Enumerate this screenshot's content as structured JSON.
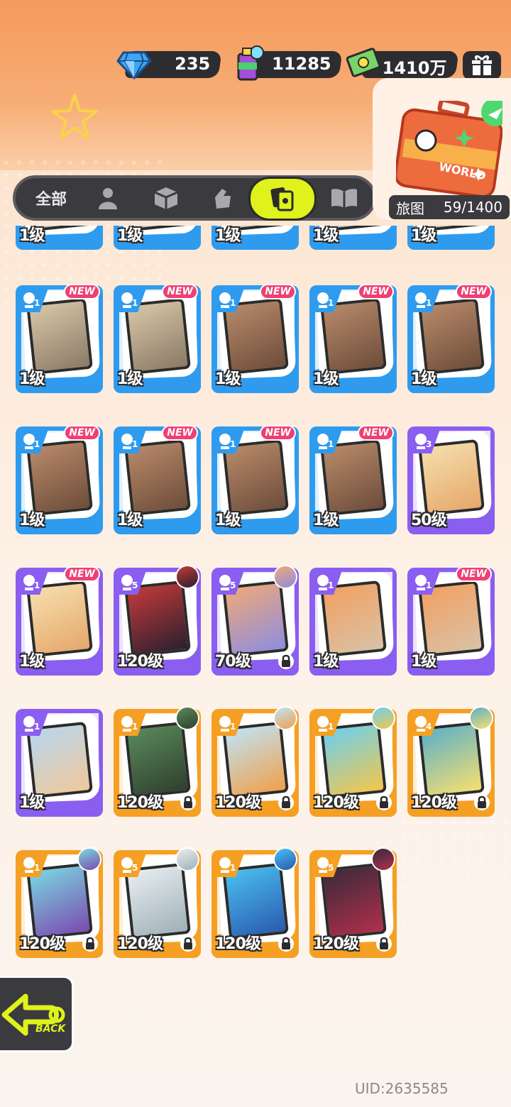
{
  "currency": {
    "diamonds": "235",
    "tickets": "11285",
    "cash": "1410万"
  },
  "tabs": {
    "all_label": "全部",
    "items": [
      "all",
      "character",
      "box",
      "hand",
      "cards",
      "book"
    ],
    "active": "cards"
  },
  "world": {
    "label": "旅图",
    "progress": "59/1400",
    "badge_text": "WORLD"
  },
  "colors": {
    "blue": "#2f9bef",
    "purple": "#8a5ef0",
    "orange": "#f5a024",
    "accent": "#dff21b"
  },
  "cards": [
    {
      "rarity": "blue",
      "num": "",
      "level": "1级",
      "new": false,
      "avatar": false,
      "lock": false,
      "partial": true
    },
    {
      "rarity": "blue",
      "num": "",
      "level": "1级",
      "new": false,
      "avatar": false,
      "lock": false,
      "partial": true
    },
    {
      "rarity": "blue",
      "num": "",
      "level": "1级",
      "new": false,
      "avatar": false,
      "lock": false,
      "partial": true
    },
    {
      "rarity": "blue",
      "num": "",
      "level": "1级",
      "new": false,
      "avatar": false,
      "lock": false,
      "partial": true
    },
    {
      "rarity": "blue",
      "num": "",
      "level": "1级",
      "new": false,
      "avatar": false,
      "lock": false,
      "partial": true
    },
    {
      "rarity": "blue",
      "num": "1",
      "level": "1级",
      "new": true,
      "avatar": false,
      "lock": false,
      "art": "tower"
    },
    {
      "rarity": "blue",
      "num": "1",
      "level": "1级",
      "new": true,
      "avatar": false,
      "lock": false,
      "art": "tower"
    },
    {
      "rarity": "blue",
      "num": "1",
      "level": "1级",
      "new": true,
      "avatar": false,
      "lock": false,
      "art": "bath"
    },
    {
      "rarity": "blue",
      "num": "1",
      "level": "1级",
      "new": true,
      "avatar": false,
      "lock": false,
      "art": "bath"
    },
    {
      "rarity": "blue",
      "num": "1",
      "level": "1级",
      "new": true,
      "avatar": false,
      "lock": false,
      "art": "bath"
    },
    {
      "rarity": "blue",
      "num": "1",
      "level": "1级",
      "new": true,
      "avatar": false,
      "lock": false,
      "art": "bath"
    },
    {
      "rarity": "blue",
      "num": "1",
      "level": "1级",
      "new": true,
      "avatar": false,
      "lock": false,
      "art": "bath"
    },
    {
      "rarity": "blue",
      "num": "1",
      "level": "1级",
      "new": true,
      "avatar": false,
      "lock": false,
      "art": "bath"
    },
    {
      "rarity": "blue",
      "num": "1",
      "level": "1级",
      "new": true,
      "avatar": false,
      "lock": false,
      "art": "bath"
    },
    {
      "rarity": "purple",
      "num": "3",
      "level": "50级",
      "new": false,
      "avatar": false,
      "lock": false,
      "art": "girl"
    },
    {
      "rarity": "purple",
      "num": "1",
      "level": "1级",
      "new": true,
      "avatar": false,
      "lock": false,
      "art": "girl"
    },
    {
      "rarity": "purple",
      "num": "5",
      "level": "120级",
      "new": false,
      "avatar": true,
      "lock": false,
      "art": "dark"
    },
    {
      "rarity": "purple",
      "num": "5",
      "level": "70级",
      "new": false,
      "avatar": true,
      "lock": true,
      "art": "robot"
    },
    {
      "rarity": "purple",
      "num": "1",
      "level": "1级",
      "new": false,
      "avatar": false,
      "lock": false,
      "art": "bear"
    },
    {
      "rarity": "purple",
      "num": "1",
      "level": "1级",
      "new": true,
      "avatar": false,
      "lock": false,
      "art": "bear"
    },
    {
      "rarity": "purple",
      "num": "1",
      "level": "1级",
      "new": false,
      "avatar": false,
      "lock": false,
      "art": "sky"
    },
    {
      "rarity": "orange",
      "num": "1",
      "level": "120级",
      "new": false,
      "avatar": true,
      "lock": true,
      "art": "green"
    },
    {
      "rarity": "orange",
      "num": "1",
      "level": "120级",
      "new": false,
      "avatar": true,
      "lock": true,
      "art": "redhair"
    },
    {
      "rarity": "orange",
      "num": "1",
      "level": "120级",
      "new": false,
      "avatar": true,
      "lock": true,
      "art": "blonde"
    },
    {
      "rarity": "orange",
      "num": "4",
      "level": "120级",
      "new": false,
      "avatar": true,
      "lock": true,
      "art": "teal"
    },
    {
      "rarity": "orange",
      "num": "1",
      "level": "120级",
      "new": false,
      "avatar": true,
      "lock": true,
      "art": "pink"
    },
    {
      "rarity": "orange",
      "num": "5",
      "level": "120级",
      "new": false,
      "avatar": true,
      "lock": true,
      "art": "white"
    },
    {
      "rarity": "orange",
      "num": "1",
      "level": "120级",
      "new": false,
      "avatar": true,
      "lock": true,
      "art": "blue"
    },
    {
      "rarity": "orange",
      "num": "5",
      "level": "120级",
      "new": false,
      "avatar": true,
      "lock": true,
      "art": "black"
    }
  ],
  "new_label": "NEW",
  "back_label": "BACK",
  "uid": "UID:2635585"
}
